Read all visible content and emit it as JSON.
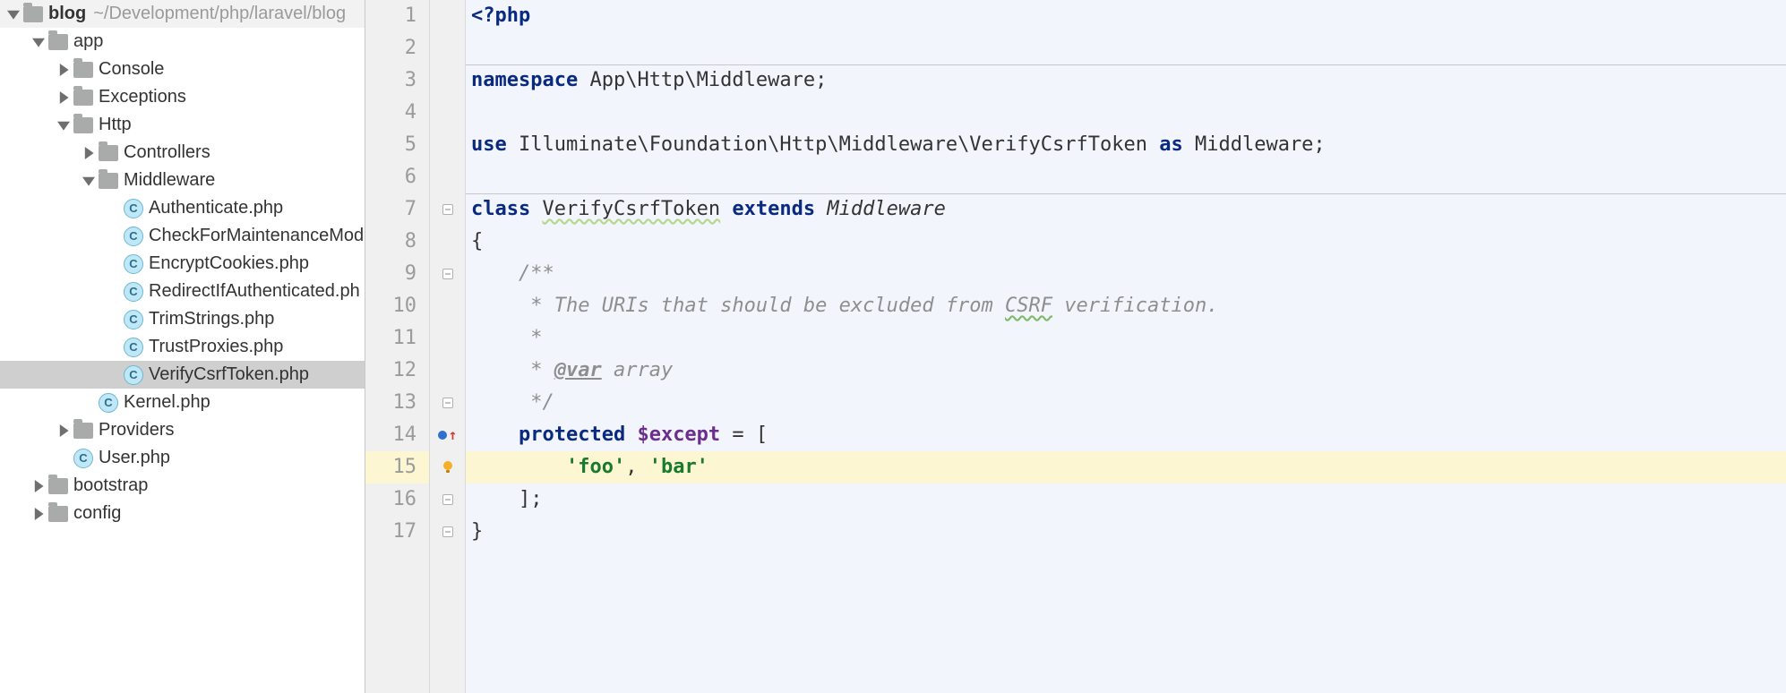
{
  "tree": {
    "root": {
      "name": "blog",
      "path": "~/Development/php/laravel/blog"
    },
    "nodes": [
      {
        "depth": 0,
        "kind": "folder",
        "label": "blog",
        "expanded": true,
        "bold": true,
        "hasPath": true
      },
      {
        "depth": 1,
        "kind": "folder",
        "label": "app",
        "expanded": true
      },
      {
        "depth": 2,
        "kind": "folder",
        "label": "Console",
        "expanded": false
      },
      {
        "depth": 2,
        "kind": "folder",
        "label": "Exceptions",
        "expanded": false
      },
      {
        "depth": 2,
        "kind": "folder",
        "label": "Http",
        "expanded": true
      },
      {
        "depth": 3,
        "kind": "folder",
        "label": "Controllers",
        "expanded": false
      },
      {
        "depth": 3,
        "kind": "folder",
        "label": "Middleware",
        "expanded": true
      },
      {
        "depth": 4,
        "kind": "class",
        "label": "Authenticate.php"
      },
      {
        "depth": 4,
        "kind": "class",
        "label": "CheckForMaintenanceMode"
      },
      {
        "depth": 4,
        "kind": "class",
        "label": "EncryptCookies.php"
      },
      {
        "depth": 4,
        "kind": "class",
        "label": "RedirectIfAuthenticated.ph"
      },
      {
        "depth": 4,
        "kind": "class",
        "label": "TrimStrings.php"
      },
      {
        "depth": 4,
        "kind": "class",
        "label": "TrustProxies.php"
      },
      {
        "depth": 4,
        "kind": "class",
        "label": "VerifyCsrfToken.php",
        "selected": true
      },
      {
        "depth": 3,
        "kind": "class",
        "label": "Kernel.php"
      },
      {
        "depth": 2,
        "kind": "folder",
        "label": "Providers",
        "expanded": false
      },
      {
        "depth": 2,
        "kind": "class",
        "label": "User.php"
      },
      {
        "depth": 1,
        "kind": "folder",
        "label": "bootstrap",
        "expanded": false
      },
      {
        "depth": 1,
        "kind": "folder",
        "label": "config",
        "expanded": false
      }
    ]
  },
  "editor": {
    "highlightLine": 15,
    "lines": [
      {
        "n": 1,
        "tokens": [
          [
            "kw",
            "<?php"
          ]
        ]
      },
      {
        "n": 2,
        "tokens": []
      },
      {
        "n": 3,
        "tokens": [
          [
            "kw",
            "namespace"
          ],
          [
            "def",
            " App\\Http\\Middleware;"
          ]
        ]
      },
      {
        "n": 4,
        "tokens": []
      },
      {
        "n": 5,
        "tokens": [
          [
            "kw",
            "use"
          ],
          [
            "def",
            " Illuminate\\Foundation\\Http\\Middleware\\VerifyCsrfToken "
          ],
          [
            "kw",
            "as"
          ],
          [
            "def",
            " Middleware;"
          ]
        ]
      },
      {
        "n": 6,
        "tokens": []
      },
      {
        "n": 7,
        "fold": true,
        "tokens": [
          [
            "kw",
            "class"
          ],
          [
            "def",
            " "
          ],
          [
            "wavy",
            "VerifyCsrfToken"
          ],
          [
            "def",
            " "
          ],
          [
            "kw",
            "extends"
          ],
          [
            "def",
            " "
          ],
          [
            "it",
            "Middleware"
          ]
        ]
      },
      {
        "n": 8,
        "tokens": [
          [
            "def",
            "{"
          ]
        ]
      },
      {
        "n": 9,
        "fold": true,
        "tokens": [
          [
            "def",
            "    "
          ],
          [
            "cm",
            "/**"
          ]
        ]
      },
      {
        "n": 10,
        "tokens": [
          [
            "def",
            "     "
          ],
          [
            "cm",
            "* The URIs that should be excluded from "
          ],
          [
            "cm-wavy",
            "CSRF"
          ],
          [
            "cm",
            " verification."
          ]
        ]
      },
      {
        "n": 11,
        "tokens": [
          [
            "def",
            "     "
          ],
          [
            "cm",
            "*"
          ]
        ]
      },
      {
        "n": 12,
        "tokens": [
          [
            "def",
            "     "
          ],
          [
            "cm",
            "* "
          ],
          [
            "doc",
            "@var"
          ],
          [
            "cm",
            " array"
          ]
        ]
      },
      {
        "n": 13,
        "fold": true,
        "tokens": [
          [
            "def",
            "     "
          ],
          [
            "cm",
            "*/"
          ]
        ]
      },
      {
        "n": 14,
        "override": true,
        "tokens": [
          [
            "def",
            "    "
          ],
          [
            "kw",
            "protected"
          ],
          [
            "def",
            " "
          ],
          [
            "var",
            "$except"
          ],
          [
            "def",
            " = ["
          ]
        ]
      },
      {
        "n": 15,
        "bulb": true,
        "tokens": [
          [
            "def",
            "        "
          ],
          [
            "str",
            "'foo'"
          ],
          [
            "def",
            ", "
          ],
          [
            "str",
            "'bar'"
          ]
        ]
      },
      {
        "n": 16,
        "fold": true,
        "tokens": [
          [
            "def",
            "    ];"
          ]
        ]
      },
      {
        "n": 17,
        "fold": true,
        "tokens": [
          [
            "def",
            "}"
          ]
        ]
      }
    ],
    "separators": [
      2,
      6
    ]
  }
}
